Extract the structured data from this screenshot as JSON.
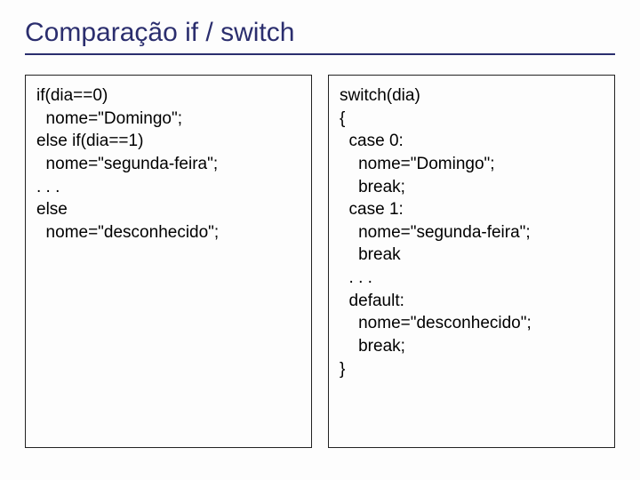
{
  "title": "Comparação if / switch",
  "left_code": "if(dia==0)\n  nome=\"Domingo\";\nelse if(dia==1)\n  nome=\"segunda-feira\";\n. . .\nelse\n  nome=\"desconhecido\";",
  "right_code": "switch(dia)\n{\n  case 0:\n    nome=\"Domingo\";\n    break;\n  case 1:\n    nome=\"segunda-feira\";\n    break\n  . . .\n  default:\n    nome=\"desconhecido\";\n    break;\n}"
}
